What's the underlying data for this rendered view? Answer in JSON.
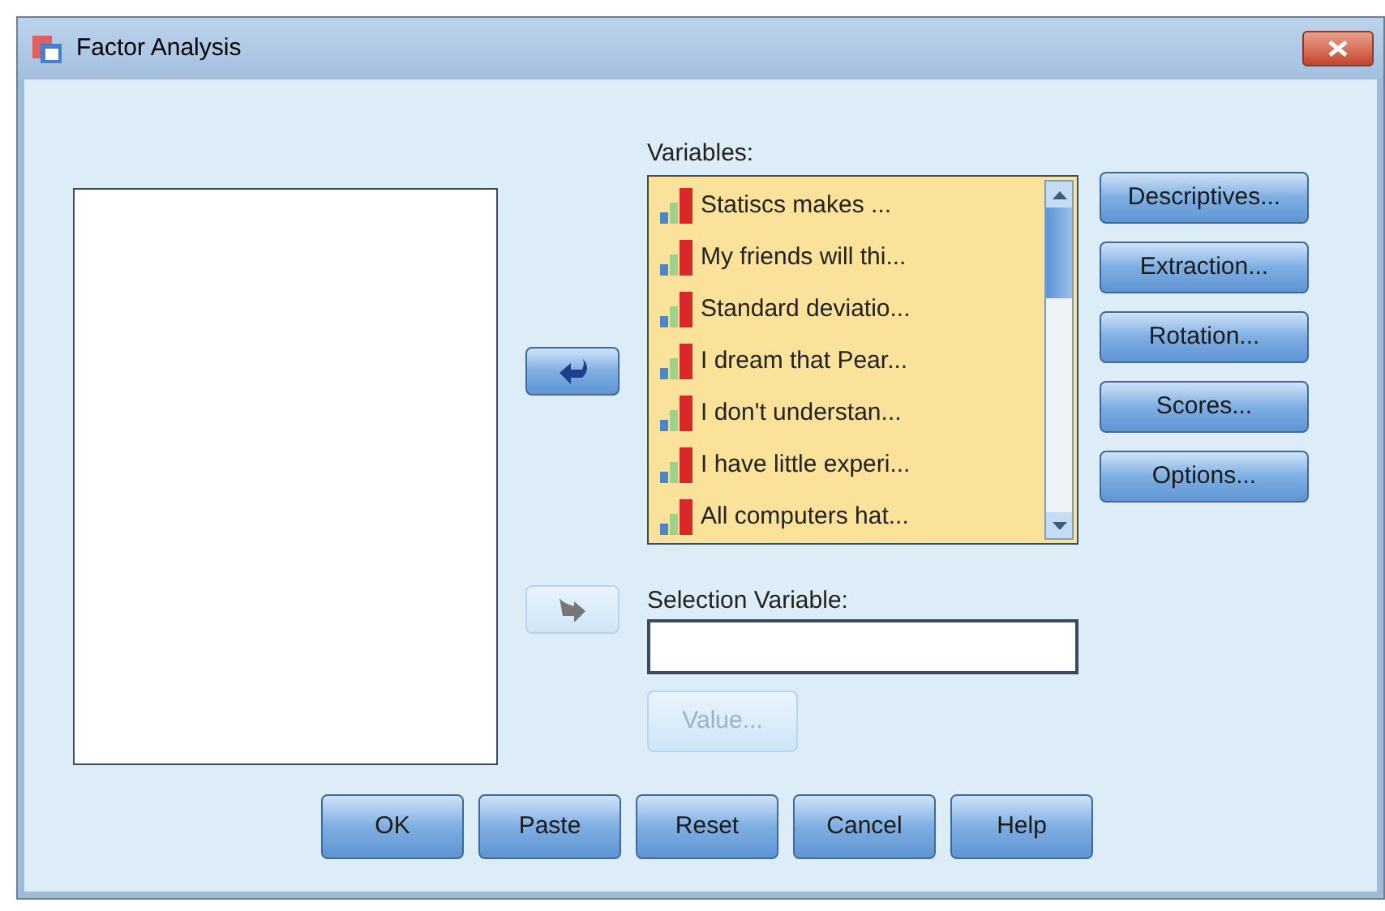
{
  "window": {
    "title": "Factor Analysis"
  },
  "variables": {
    "label": "Variables:",
    "items": [
      {
        "name": "Statiscs makes ..."
      },
      {
        "name": "My friends will thi..."
      },
      {
        "name": "Standard deviatio..."
      },
      {
        "name": "I dream that Pear..."
      },
      {
        "name": "I don't understan..."
      },
      {
        "name": "I have little experi..."
      },
      {
        "name": "All computers hat..."
      }
    ]
  },
  "move_buttons": [
    {
      "kind": "left",
      "disabled": false
    },
    {
      "kind": "right",
      "disabled": true
    }
  ],
  "side_buttons": [
    "Descriptives...",
    "Extraction...",
    "Rotation...",
    "Scores...",
    "Options..."
  ],
  "selection_variable": {
    "label": "Selection Variable:"
  },
  "value_button": {
    "label": "Value...",
    "disabled": true
  },
  "buttons": [
    "OK",
    "Paste",
    "Reset",
    "Cancel",
    "Help"
  ]
}
